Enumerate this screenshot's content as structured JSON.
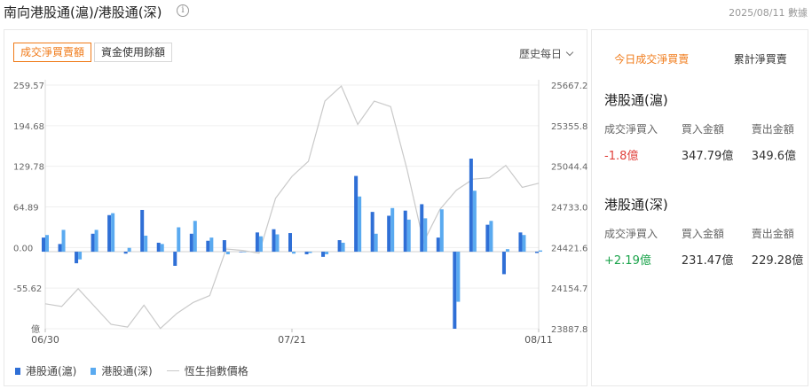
{
  "header": {
    "title": "南向港股通(滬)/港股通(深)",
    "info_icon": "info-icon",
    "date_note": "2025/08/11 數據"
  },
  "tabs": [
    {
      "label": "成交淨買賣額",
      "active": true
    },
    {
      "label": "資金使用餘額",
      "active": false
    }
  ],
  "period_select": "歷史每日",
  "legend": [
    {
      "label": "港股通(滬)",
      "color": "#2f6fd6"
    },
    {
      "label": "港股通(深)",
      "color": "#5aaaf0"
    },
    {
      "label": "恆生指數價格",
      "color": "#c9c9c9"
    }
  ],
  "chart_data": {
    "type": "bar",
    "unit_label": "億",
    "left_axis_ticks": [
      "259.57",
      "194.68",
      "129.78",
      "64.89",
      "0.00",
      "-55.62"
    ],
    "right_axis_ticks": [
      "25667.2",
      "25355.8",
      "25044.4",
      "24733.0",
      "24421.6",
      "24154.7",
      "23887.8"
    ],
    "left_ylim": [
      -120,
      259.57
    ],
    "right_ylim": [
      23887.8,
      25667.2
    ],
    "x_tick_labels": [
      {
        "index": 0,
        "label": "06/30"
      },
      {
        "index": 15,
        "label": "07/21"
      },
      {
        "index": 30,
        "label": "08/11"
      }
    ],
    "x": [
      "06/30",
      "07/01",
      "07/02",
      "07/03",
      "07/04",
      "07/07",
      "07/08",
      "07/09",
      "07/10",
      "07/11",
      "07/14",
      "07/15",
      "07/16",
      "07/17",
      "07/18",
      "07/21",
      "07/22",
      "07/23",
      "07/24",
      "07/25",
      "07/28",
      "07/29",
      "07/30",
      "07/31",
      "08/01",
      "08/04",
      "08/05",
      "08/06",
      "08/07",
      "08/08",
      "08/11"
    ],
    "series": [
      {
        "name": "港股通(滬)",
        "kind": "bar",
        "axis": "left",
        "color": "#2f6fd6",
        "values": [
          22,
          12,
          -18,
          28,
          57,
          -3,
          65,
          14,
          -22,
          28,
          17,
          18,
          0,
          30,
          35,
          29,
          -4,
          -8,
          18,
          118,
          62,
          56,
          64,
          74,
          22,
          -120,
          145,
          42,
          -35,
          30,
          -2
        ]
      },
      {
        "name": "港股通(深)",
        "kind": "bar",
        "axis": "left",
        "color": "#5aaaf0",
        "values": [
          26,
          34,
          -12,
          34,
          60,
          6,
          25,
          12,
          38,
          48,
          22,
          -4,
          0,
          24,
          27,
          -3,
          -2,
          -4,
          14,
          86,
          28,
          68,
          50,
          52,
          66,
          -78,
          95,
          48,
          4,
          26,
          2
        ]
      },
      {
        "name": "恆生指數價格",
        "kind": "line",
        "axis": "right",
        "color": "#c9c9c9",
        "values": [
          24070,
          24050,
          24180,
          24050,
          23920,
          23900,
          24060,
          23890,
          24000,
          24080,
          24130,
          24470,
          24460,
          24440,
          24840,
          25000,
          25110,
          25550,
          25660,
          25380,
          25550,
          25510,
          25050,
          24520,
          24760,
          24900,
          24980,
          24990,
          25080,
          24920,
          24950
        ]
      }
    ]
  },
  "side": {
    "tabs": [
      {
        "label": "今日成交淨買賣",
        "active": true
      },
      {
        "label": "累計淨買賣",
        "active": false
      }
    ],
    "sh": {
      "title": "港股通(滬)",
      "labels": [
        "成交淨買入",
        "買入金額",
        "賣出金額"
      ],
      "net": "-1.8億",
      "net_color": "#e0403b",
      "buy": "347.79億",
      "sell": "349.6億"
    },
    "sz": {
      "title": "港股通(深)",
      "labels": [
        "成交淨買入",
        "買入金額",
        "賣出金額"
      ],
      "net": "+2.19億",
      "net_color": "#1aa34a",
      "buy": "231.47億",
      "sell": "229.28億"
    }
  }
}
